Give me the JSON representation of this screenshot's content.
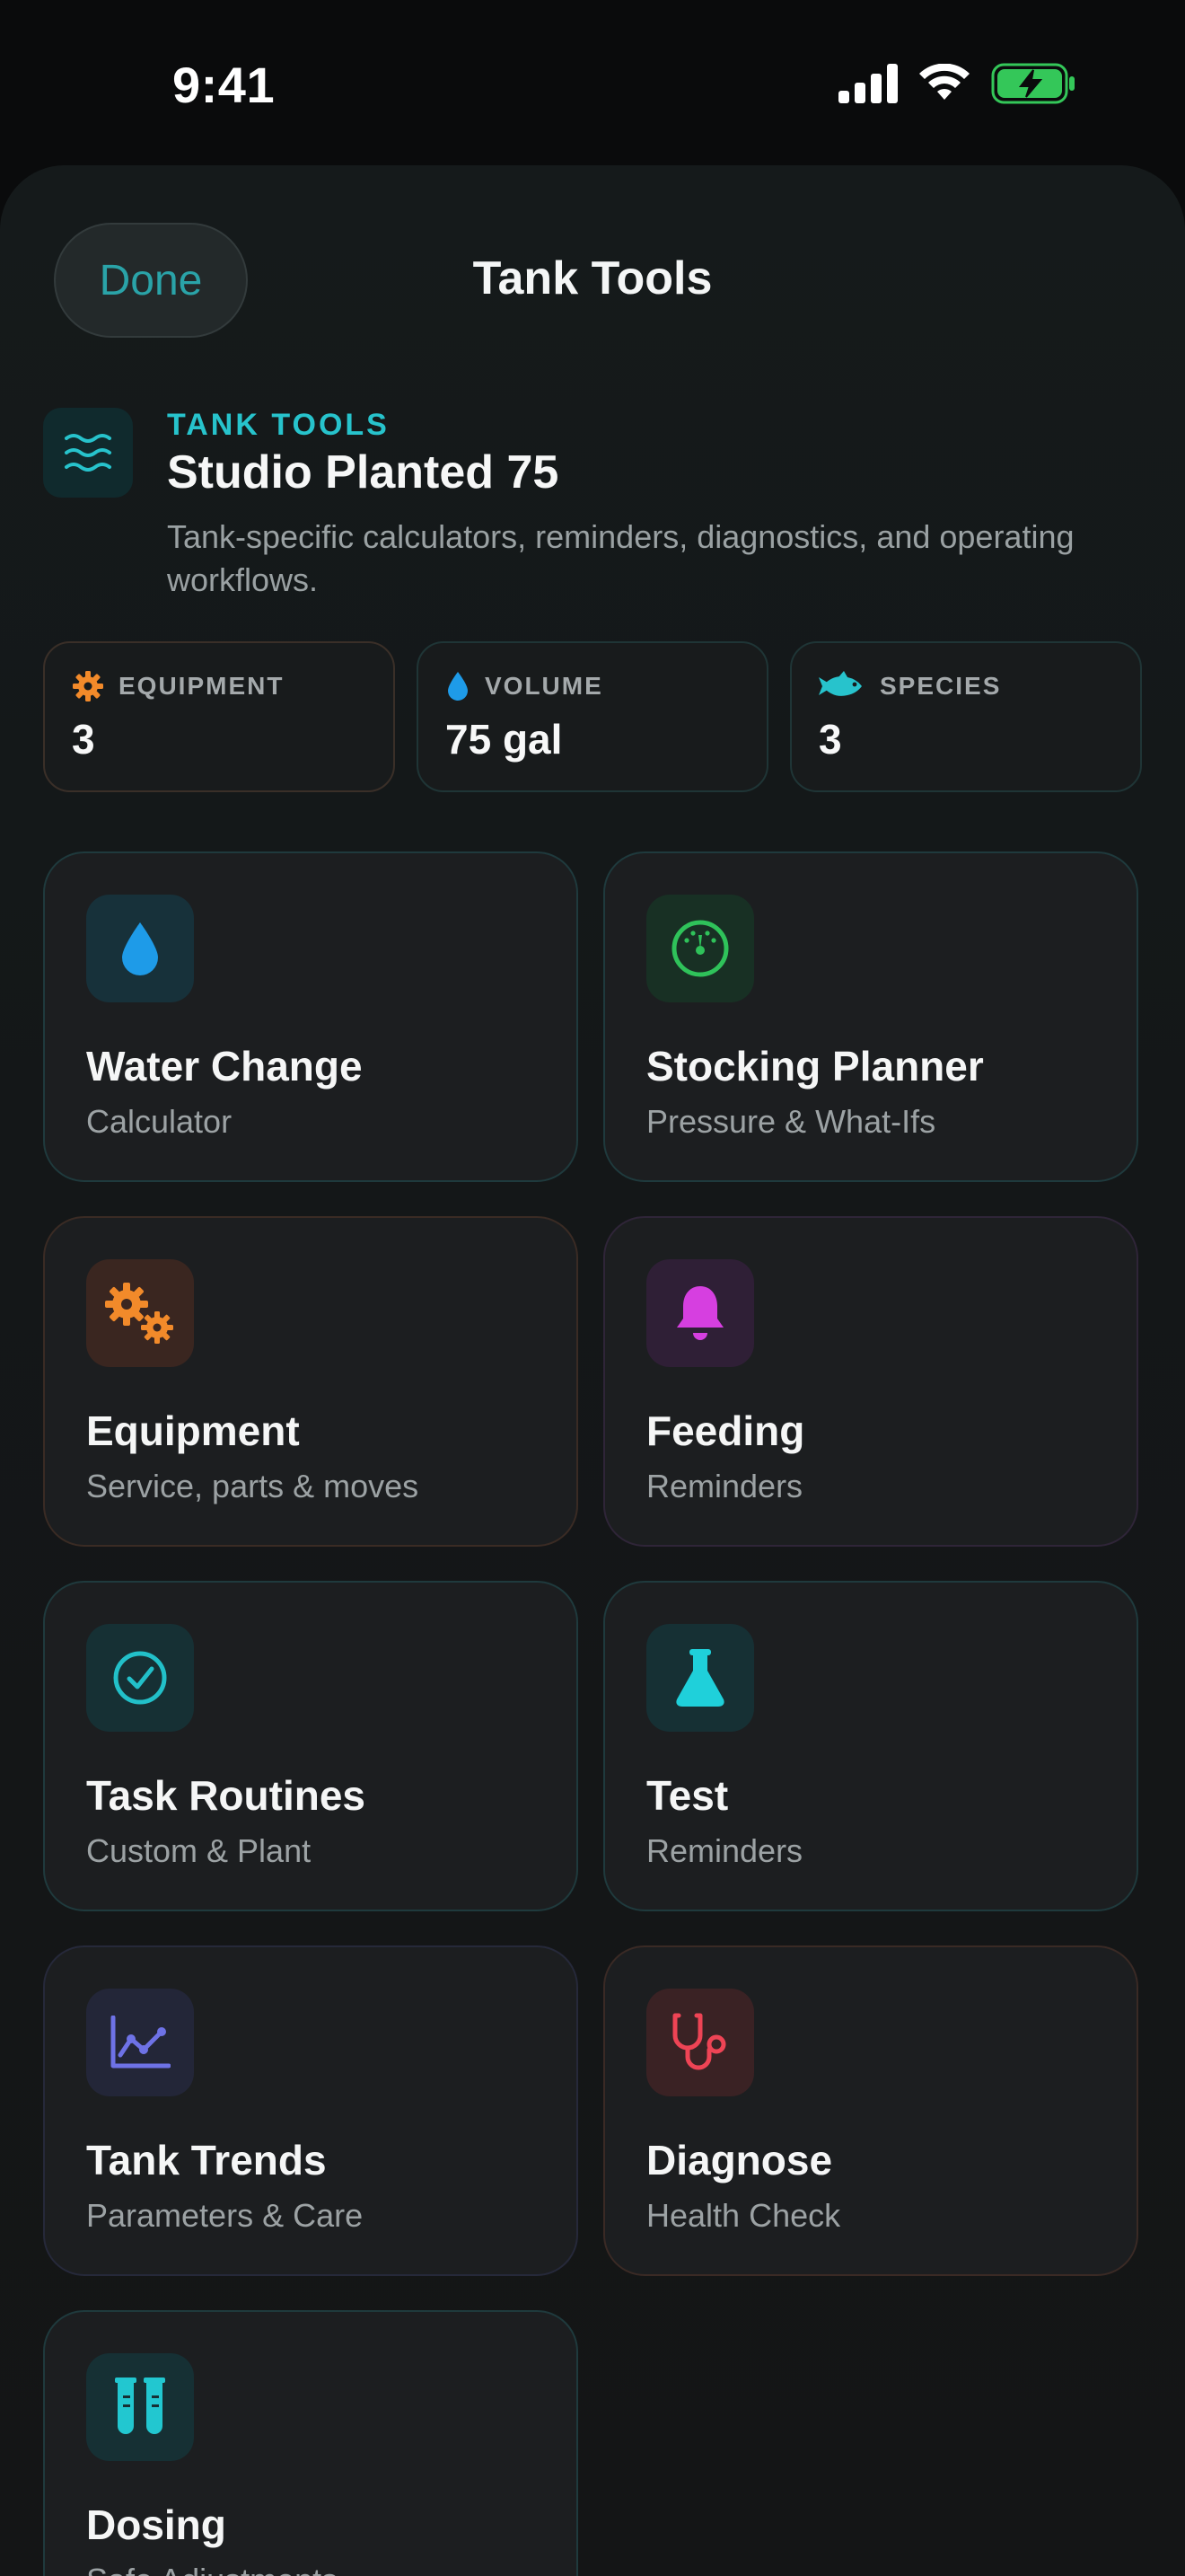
{
  "status_bar": {
    "time": "9:41"
  },
  "nav": {
    "done_label": "Done",
    "title": "Tank Tools"
  },
  "header": {
    "eyebrow": "TANK TOOLS",
    "tank_name": "Studio Planted 75",
    "description": "Tank-specific calculators, reminders, diagnostics, and operating workflows."
  },
  "stats": [
    {
      "icon": "gear-icon",
      "label": "EQUIPMENT",
      "value": "3"
    },
    {
      "icon": "water-drop-icon",
      "label": "VOLUME",
      "value": "75 gal"
    },
    {
      "icon": "fish-icon",
      "label": "SPECIES",
      "value": "3"
    }
  ],
  "tools": [
    {
      "icon": "water-drop-icon",
      "title": "Water Change",
      "subtitle": "Calculator",
      "accent": "#1e9be8"
    },
    {
      "icon": "gauge-icon",
      "title": "Stocking Planner",
      "subtitle": "Pressure & What-Ifs",
      "accent": "#2fc25a"
    },
    {
      "icon": "gears-icon",
      "title": "Equipment",
      "subtitle": "Service, parts & moves",
      "accent": "#f28a2a"
    },
    {
      "icon": "bell-icon",
      "title": "Feeding",
      "subtitle": "Reminders",
      "accent": "#d63fe0"
    },
    {
      "icon": "checkmark-circle-icon",
      "title": "Task Routines",
      "subtitle": "Custom & Plant",
      "accent": "#22c0c9"
    },
    {
      "icon": "flask-icon",
      "title": "Test",
      "subtitle": "Reminders",
      "accent": "#1fd0da"
    },
    {
      "icon": "line-chart-icon",
      "title": "Tank Trends",
      "subtitle": "Parameters & Care",
      "accent": "#6e72e6"
    },
    {
      "icon": "stethoscope-icon",
      "title": "Diagnose",
      "subtitle": "Health Check",
      "accent": "#ee4455"
    },
    {
      "icon": "test-tubes-icon",
      "title": "Dosing",
      "subtitle": "Safe Adjustments",
      "accent": "#22c7d0"
    }
  ]
}
